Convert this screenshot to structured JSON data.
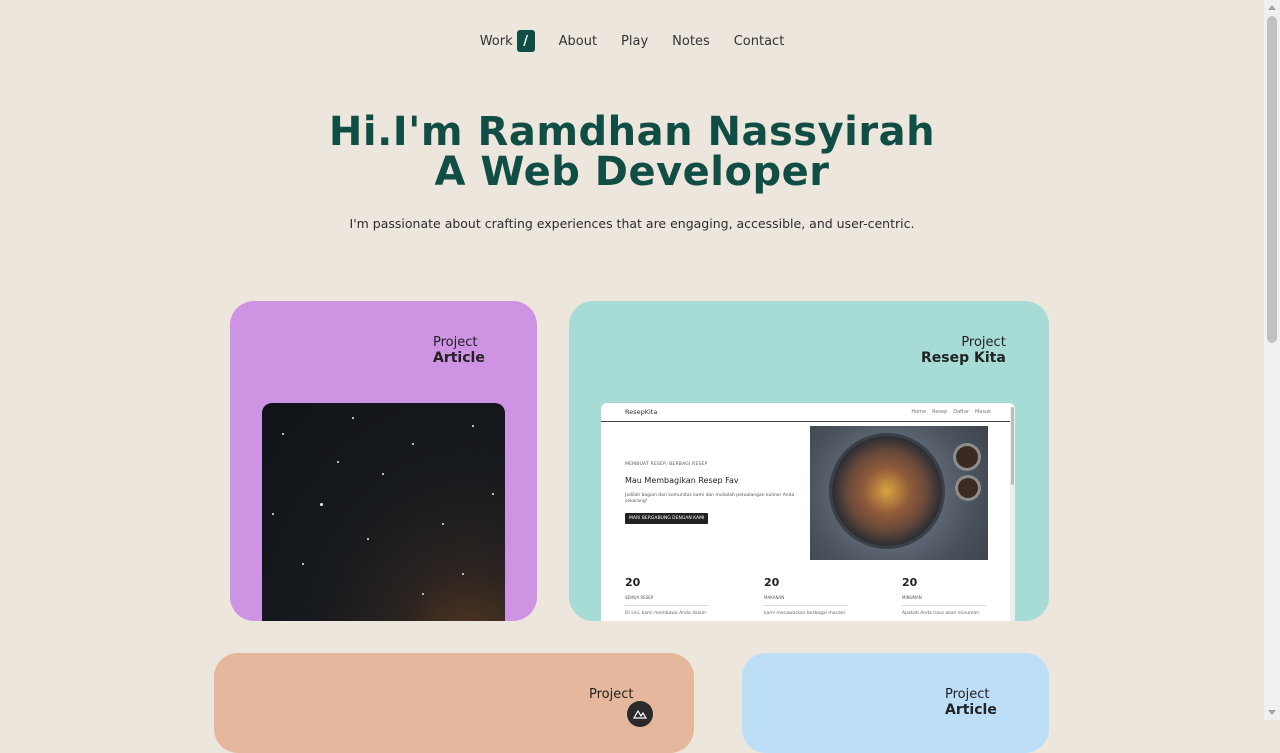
{
  "nav": {
    "items": [
      "Work",
      "About",
      "Play",
      "Notes",
      "Contact"
    ],
    "slash": "/"
  },
  "hero": {
    "line1": "Hi.I'm Ramdhan Nassyirah",
    "line2": "A Web Developer",
    "tagline": "I'm passionate about crafting experiences that are engaging, accessible, and user-centric."
  },
  "cards": [
    {
      "kicker": "Project",
      "name": "Article",
      "color": "#cf93e3"
    },
    {
      "kicker": "Project",
      "name": "Resep Kita",
      "color": "#a6dcd5"
    },
    {
      "kicker": "Project",
      "name": "",
      "color": "#e5b79c"
    },
    {
      "kicker": "Project",
      "name": "Article",
      "color": "#bcdef7"
    }
  ],
  "resep_preview": {
    "brand": "ResepKita",
    "links": [
      "Home",
      "Resep",
      "Daftar",
      "Masuk"
    ],
    "eyebrow": "MEMBUAT RESEP, BERBAGI RESEP",
    "title": "Mau Membagikan Resep Fav",
    "desc": "Jadilah bagian dari komunitas kami dan mulailah petualangan kuliner Anda sekarang!",
    "button": "MARI BERGABUNG DENGAN KAMI",
    "stats": [
      {
        "num": "20",
        "cap": "SEMUA RESEP",
        "txt": "Di sini, kami membawa Anda dalam"
      },
      {
        "num": "20",
        "cap": "MAKANAN",
        "txt": "kami menawarkan berbagai macam"
      },
      {
        "num": "20",
        "cap": "MINUMAN",
        "txt": "Apakah Anda haus akan minuman"
      }
    ]
  },
  "colors": {
    "accent": "#0f4d45",
    "background": "#ede6dd"
  }
}
